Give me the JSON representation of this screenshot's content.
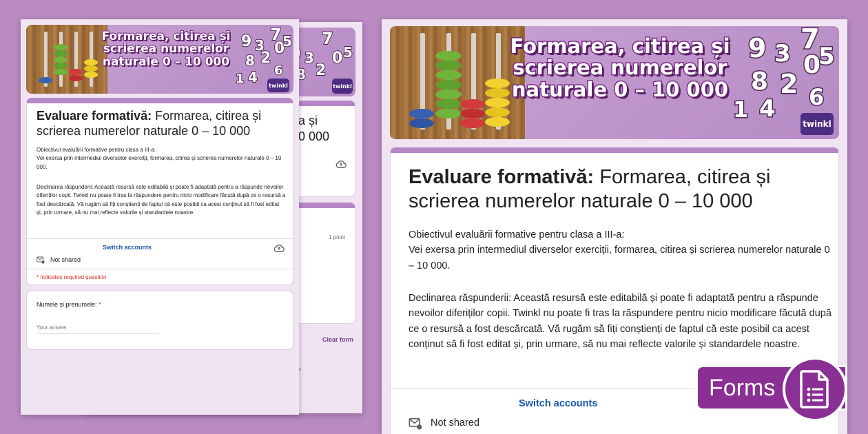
{
  "banner": {
    "title_line1": "Formarea, citirea și",
    "title_line2": "scrierea numerelor",
    "title_line3": "naturale 0 – 10 000",
    "digits": [
      "9",
      "3",
      "7",
      "8",
      "2",
      "0",
      "5",
      "1",
      "4",
      "6"
    ],
    "brand": "twinkl"
  },
  "form": {
    "title_bold": "Evaluare formativă:",
    "title_rest": " Formarea, citirea și scrierea numerelor naturale 0 – 10 000",
    "description_objective": "Obiectivul evaluării formative pentru clasa a III-a:\nVei exersa prin intermediul diverselor exerciții, formarea, citirea și scrierea numerelor naturale 0 – 10 000.",
    "description_disclaimer": "Declinarea răspunderii: Această resursă este editabilă și poate fi adaptată pentru a răspunde nevoilor diferiților copii. Twinkl nu poate fi tras la răspundere pentru nicio modificare făcută după ce o resursă a fost descărcată. Vă rugăm să fiți conștienți de faptul că este posibil ca acest conținut să fi fost editat și, prin urmare, să nu mai reflecte valorile și standardele noastre.",
    "switch_accounts": "Switch accounts",
    "not_shared": "Not shared",
    "required_note": "* Indicates required question",
    "question1_label": "Numele și prenumele:",
    "question1_required": "*",
    "answer_placeholder": "Your answer"
  },
  "back_page": {
    "title_fragment_1": "a și",
    "title_fragment_2": "0 000",
    "points": "1 point",
    "clear_form": "Clear form",
    "footer_fragment": "ge"
  },
  "badge": {
    "label": "Forms"
  },
  "colors": {
    "background": "#b98bc2",
    "accent_purple": "#8a2f94",
    "link_blue": "#1a57a8",
    "required_red": "#d93025"
  }
}
